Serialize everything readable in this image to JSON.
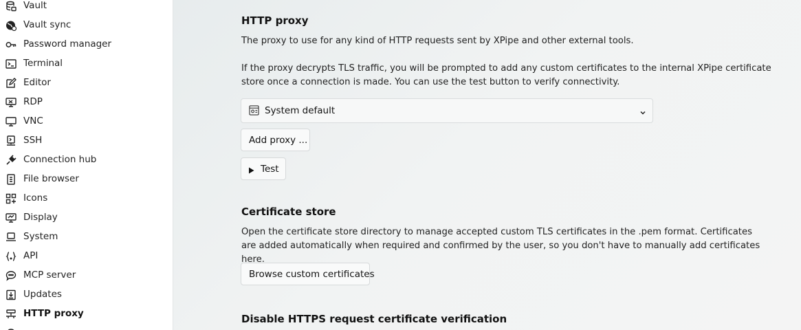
{
  "sidebar": {
    "items": [
      {
        "label": "Vault",
        "icon": "vault-icon"
      },
      {
        "label": "Vault sync",
        "icon": "globe-sync-icon"
      },
      {
        "label": "Password manager",
        "icon": "key-icon"
      },
      {
        "label": "Terminal",
        "icon": "terminal-icon"
      },
      {
        "label": "Editor",
        "icon": "edit-icon"
      },
      {
        "label": "RDP",
        "icon": "remote-desktop-icon"
      },
      {
        "label": "VNC",
        "icon": "monitor-icon"
      },
      {
        "label": "SSH",
        "icon": "ssh-icon"
      },
      {
        "label": "Connection hub",
        "icon": "plug-icon"
      },
      {
        "label": "File browser",
        "icon": "file-browser-icon"
      },
      {
        "label": "Icons",
        "icon": "icons-grid-icon"
      },
      {
        "label": "Display",
        "icon": "display-icon"
      },
      {
        "label": "System",
        "icon": "laptop-icon"
      },
      {
        "label": "API",
        "icon": "braces-icon"
      },
      {
        "label": "MCP server",
        "icon": "chat-icon"
      },
      {
        "label": "Updates",
        "icon": "download-icon"
      },
      {
        "label": "HTTP proxy",
        "icon": "network-icon",
        "active": true
      }
    ]
  },
  "proxy": {
    "title": "HTTP proxy",
    "description": "The proxy to use for any kind of HTTP requests sent by XPipe and other external tools.",
    "tls_note": "If the proxy decrypts TLS traffic, you will be prompted to add any custom certificates to the internal XPipe certificate store once a connection is made. You can use the test button to verify connectivity.",
    "select_value": "System default",
    "add_button": "Add proxy ...",
    "test_button": "Test"
  },
  "cert": {
    "title": "Certificate store",
    "description": "Open the certificate store directory to manage accepted custom TLS certificates in the .pem format. Certificates are added automatically when required and confirmed by the user, so you don't have to manually add certificates here.",
    "browse_button": "Browse custom certificates"
  },
  "https": {
    "title": "Disable HTTPS request certificate verification"
  },
  "colors": {
    "sidebar_bg": "#ffffff",
    "main_bg": "#edf0f0",
    "border": "#d6d9da"
  }
}
